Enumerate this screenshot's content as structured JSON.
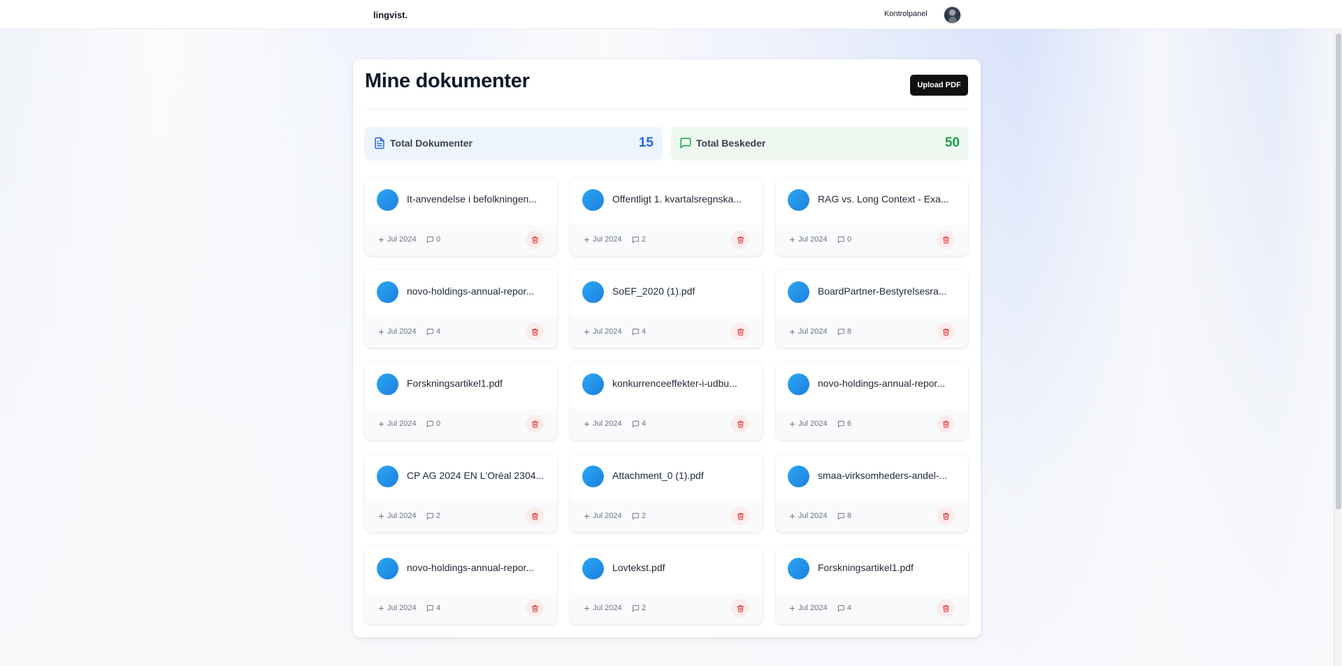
{
  "app": {
    "logo": "lingvist."
  },
  "nav": {
    "dashboard_link": "Kontrolpanel"
  },
  "header": {
    "title": "Mine dokumenter",
    "upload_label": "Upload PDF"
  },
  "stats": {
    "documents": {
      "label": "Total Dokumenter",
      "value": "15"
    },
    "messages": {
      "label": "Total Beskeder",
      "value": "50"
    }
  },
  "documents": [
    {
      "title": "It-anvendelse i befolkningen...",
      "date": "Jul 2024",
      "messages": "0"
    },
    {
      "title": "Offentligt 1. kvartalsregnska...",
      "date": "Jul 2024",
      "messages": "2"
    },
    {
      "title": "RAG vs. Long Context - Exa...",
      "date": "Jul 2024",
      "messages": "0"
    },
    {
      "title": "novo-holdings-annual-repor...",
      "date": "Jul 2024",
      "messages": "4"
    },
    {
      "title": "SoEF_2020 (1).pdf",
      "date": "Jul 2024",
      "messages": "4"
    },
    {
      "title": "BoardPartner-Bestyrelsesra...",
      "date": "Jul 2024",
      "messages": "8"
    },
    {
      "title": "Forskningsartikel1.pdf",
      "date": "Jul 2024",
      "messages": "0"
    },
    {
      "title": "konkurrenceeffekter-i-udbu...",
      "date": "Jul 2024",
      "messages": "4"
    },
    {
      "title": "novo-holdings-annual-repor...",
      "date": "Jul 2024",
      "messages": "6"
    },
    {
      "title": "CP AG 2024 EN L'Oréal 2304...",
      "date": "Jul 2024",
      "messages": "2"
    },
    {
      "title": "Attachment_0 (1).pdf",
      "date": "Jul 2024",
      "messages": "2"
    },
    {
      "title": "smaa-virksomheders-andel-...",
      "date": "Jul 2024",
      "messages": "8"
    },
    {
      "title": "novo-holdings-annual-repor...",
      "date": "Jul 2024",
      "messages": "4"
    },
    {
      "title": "Lovtekst.pdf",
      "date": "Jul 2024",
      "messages": "2"
    },
    {
      "title": "Forskningsartikel1.pdf",
      "date": "Jul 2024",
      "messages": "4"
    }
  ],
  "icons": {
    "file": "file-text-icon",
    "chat": "message-square-icon",
    "plus": "plus-icon",
    "trash": "trash-icon"
  },
  "colors": {
    "accent_blue": "#2563eb",
    "accent_green": "#16a34a",
    "danger": "#dc2626",
    "button_dark": "#111111"
  }
}
